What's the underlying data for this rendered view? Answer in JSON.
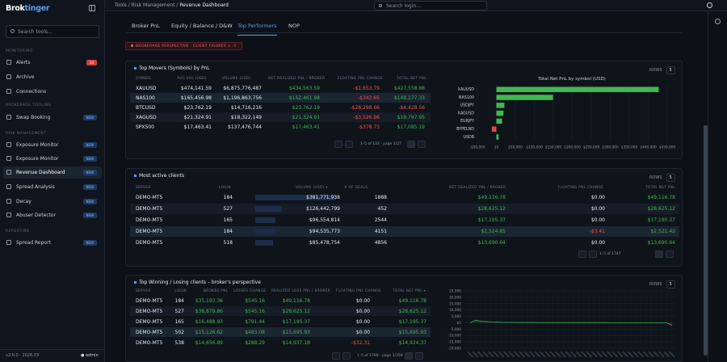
{
  "app": {
    "logo_a": "Brok",
    "logo_b": "tinger"
  },
  "sidebar": {
    "search_placeholder": "Search tools...",
    "sections": [
      "Monitoring",
      "Brokerage Tooling",
      "Risk Management",
      "Reporting"
    ],
    "items": [
      {
        "label": "Alerts",
        "badge": "14"
      },
      {
        "label": "Archive",
        "badge": ""
      },
      {
        "label": "Connections",
        "badge": ""
      },
      {
        "label": "Swap Booking",
        "badge": "NEW"
      },
      {
        "label": "Exposure Monitor",
        "badge": "NEW"
      },
      {
        "label": "Exposure Monitor",
        "badge": "NEW"
      },
      {
        "label": "Revenue Dashboard",
        "badge": "NEW"
      },
      {
        "label": "Spread Analysis",
        "badge": "NEW"
      },
      {
        "label": "Decay",
        "badge": "NEW"
      },
      {
        "label": "Abuser Detector",
        "badge": "NEW"
      },
      {
        "label": "Spread Report",
        "badge": "NEW"
      }
    ],
    "version": "v2.0.0 · 2026.03",
    "user": "admin"
  },
  "topbar": {
    "crumb1": "Tools",
    "crumb2": "Risk Management",
    "crumb3": "Revenue Dashboard",
    "search_placeholder": "Search login..."
  },
  "tabs": [
    "Broker PnL",
    "Equity / Balance / D&W",
    "Top Performers",
    "NOP"
  ],
  "banner": "BROKERAGE PERSPECTIVE · CLIENT FIGURES × -1",
  "movers": {
    "title": "Top Movers (Symbols) by PnL",
    "rows_label": "ROWS",
    "rows_value": "5",
    "headers": [
      "SYMBOL",
      "AVG VOL (USD)",
      "VOLUME (USD)",
      "NET REALIZED PNL / BROKER",
      "FLOATING PNL CHANGE",
      "TOTAL NET PNL"
    ],
    "rows": [
      [
        "XAUUSD",
        "$474,141.59",
        "$6,875,776,487",
        "$434,563.59",
        "-$1,653.79",
        "$427,558.88"
      ],
      [
        "NAS100",
        "$165,456.98",
        "$1,196,863,756",
        "$152,461.98",
        "-$343.65",
        "$149,177.33"
      ],
      [
        "BTCUSD",
        "$23,762.19",
        "$14,716,216",
        "$23,762.19",
        "-$28,298.66",
        "-$4,428.56"
      ],
      [
        "XAGUSD",
        "$21,324.91",
        "$18,322,149",
        "$21,324.91",
        "-$3,526.96",
        "$18,797.95"
      ],
      [
        "SPX500",
        "$17,463.41",
        "$137,476,744",
        "$17,463.41",
        "-$378.73",
        "$17,085.19"
      ]
    ],
    "pager": "1–5 of 133",
    "pager_page": "page 1/27"
  },
  "movers_chart": {
    "title": "Total Net PnL by symbol (USD)",
    "labels": [
      "XAUUSD",
      "NAS100",
      "USDJPY",
      "XAGUSD",
      "EURJPY",
      "BYPELND",
      "USDB"
    ],
    "ticks": [
      "-$50,000",
      "$0",
      "$50,000",
      "$100,000",
      "$150,000",
      "$200,000",
      "$250,000",
      "$300,000",
      "$350,000",
      "$400,000",
      "$450,000"
    ]
  },
  "chart_data": [
    {
      "type": "bar",
      "title": "Total Net PnL by symbol (USD)",
      "categories": [
        "XAUUSD",
        "NAS100",
        "USDJPY",
        "XAGUSD",
        "EURJPY",
        "BYPELND",
        "USDB"
      ],
      "values": [
        427558,
        149177,
        21000,
        18797,
        15000,
        -12000,
        6000
      ],
      "xlim": [
        -50000,
        450000
      ]
    },
    {
      "type": "line",
      "categories": [],
      "series": [
        {
          "values": [
            0,
            2000,
            1200,
            900,
            600,
            400,
            300,
            250,
            200,
            180,
            150,
            130,
            120,
            110,
            100,
            95,
            90,
            85,
            80,
            80,
            75,
            70,
            65,
            60,
            60,
            55,
            50,
            50,
            45,
            40,
            35,
            30,
            30,
            25,
            20,
            15,
            -2000
          ]
        }
      ],
      "ylim": [
        -20000,
        25000
      ]
    }
  ],
  "clients": {
    "title": "Most active clients",
    "rows_label": "ROWS",
    "rows_value": "5",
    "headers": [
      "SERVER",
      "LOGIN",
      "VOLUME (USD) ▾",
      "# OF DEALS",
      "NET REALIZED PNL / BROKER",
      "FLOATING PNL CHANGE",
      "TOTAL NET PNL"
    ],
    "rows": [
      [
        "DEMO-MT5",
        "184",
        "$381,771,938",
        "1888",
        "$49,116.78",
        "$0.00",
        "$49,116.78"
      ],
      [
        "DEMO-MT5",
        "527",
        "$126,442,799",
        "452",
        "$28,625.12",
        "$0.00",
        "$28,625.12"
      ],
      [
        "DEMO-MT5",
        "165",
        "$96,554,814",
        "2544",
        "$17,195.37",
        "$0.00",
        "$17,195.37"
      ],
      [
        "DEMO-MT5",
        "184",
        "$94,535,773",
        "4151",
        "$2,524.85",
        "-$3.41",
        "$2,521.42"
      ],
      [
        "DEMO-MT5",
        "518",
        "$85,478,754",
        "4856",
        "$13,690.64",
        "$0.00",
        "$13,690.64"
      ]
    ],
    "vol_frac": [
      1.0,
      0.33,
      0.25,
      0.25,
      0.22
    ],
    "pager": "1–5 of 1747"
  },
  "winners": {
    "title": "Top Winning / Losing clients – broker's perspective",
    "rows_label": "ROWS",
    "rows_value": "5",
    "headers": [
      "SERVER",
      "LOGIN",
      "BROKER PNL",
      "LOSSES CHANGE",
      "REALIZED LOSS PNL / BROKER",
      "FLOATING PNL CHANGE",
      "TOTAL NET PNL ▾"
    ],
    "rows": [
      [
        "DEMO-MT5",
        "184",
        "$35,193.36",
        "$545.16",
        "$49,116.78",
        "$0.00",
        "$49,116.78"
      ],
      [
        "DEMO-MT5",
        "527",
        "$38,879.86",
        "$545.16",
        "$28,625.12",
        "$0.00",
        "$28,625.12"
      ],
      [
        "DEMO-MT5",
        "165",
        "$16,488.93",
        "$791.44",
        "$17,195.37",
        "$0.00",
        "$17,195.37"
      ],
      [
        "DEMO-MT5",
        "502",
        "$15,126.62",
        "$483.08",
        "$15,695.93",
        "$0.00",
        "$15,695.93"
      ],
      [
        "DEMO-MT5",
        "538",
        "$14,656.89",
        "$288.29",
        "$14,937.18",
        "-$32.31",
        "$14,924.37"
      ]
    ],
    "pager": "1–5 of 1788",
    "pager_page": "page 1/358"
  },
  "winners_chart": {
    "ticks": [
      "25,000",
      "20,000",
      "15,000",
      "10,000",
      "5,000",
      "$0",
      "-5,000",
      "-10,000",
      "-15,000",
      "-20,000"
    ]
  }
}
